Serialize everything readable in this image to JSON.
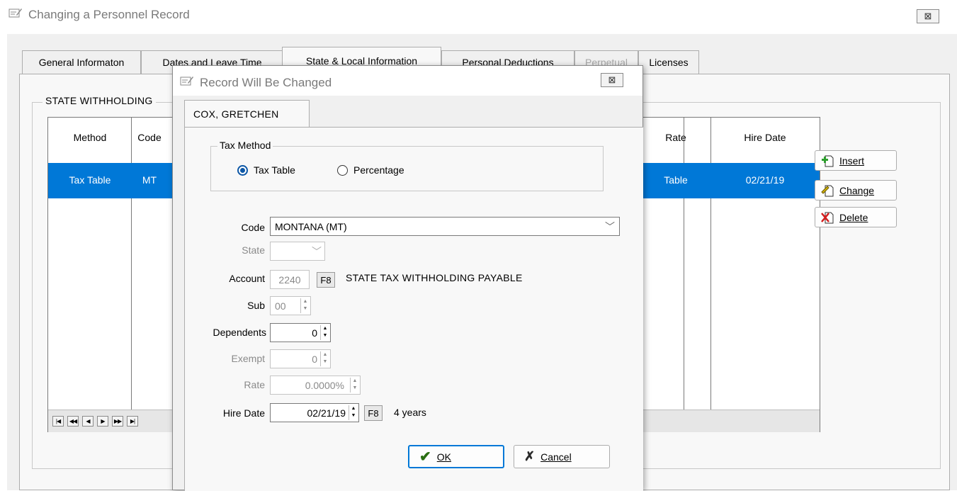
{
  "outer_window": {
    "title": "Changing a Personnel Record",
    "close_symbol": "⊠"
  },
  "tabs": [
    {
      "label": "General Informaton"
    },
    {
      "label": "Dates and Leave Time"
    },
    {
      "label": "State & Local Information"
    },
    {
      "label": "Personal Deductions"
    },
    {
      "label": "Perpetual"
    },
    {
      "label": "Licenses"
    }
  ],
  "state_group": {
    "label": "STATE WITHHOLDING"
  },
  "grid": {
    "headers": {
      "method": "Method",
      "code": "Code",
      "rate": "Rate",
      "hire_date": "Hire Date"
    },
    "selected_row": {
      "method": "Tax Table",
      "code": "MT",
      "rate": "Table",
      "hire_date": "02/21/19"
    },
    "selection_color": "#0078d7"
  },
  "side_buttons": {
    "insert": "Insert",
    "change": "Change",
    "delete": "Delete"
  },
  "dialog": {
    "title": "Record Will Be Changed",
    "tab_label": "COX, GRETCHEN",
    "tax_method": {
      "label": "Tax Method",
      "option_table": "Tax Table",
      "option_percentage": "Percentage",
      "selected": "Tax Table"
    },
    "fields": {
      "code_label": "Code",
      "code_value": "MONTANA (MT)",
      "state_label": "State",
      "state_value": "",
      "account_label": "Account",
      "account_value": "2240",
      "account_f8": "F8",
      "account_desc": "STATE TAX WITHHOLDING PAYABLE",
      "sub_label": "Sub",
      "sub_value": "00",
      "dependents_label": "Dependents",
      "dependents_value": "0",
      "exempt_label": "Exempt",
      "exempt_value": "0",
      "rate_label": "Rate",
      "rate_value": "0.0000%",
      "hire_label": "Hire Date",
      "hire_value": "02/21/19",
      "hire_f8": "F8",
      "hire_note": "4 years"
    },
    "buttons": {
      "ok": "OK",
      "cancel": "Cancel"
    }
  }
}
